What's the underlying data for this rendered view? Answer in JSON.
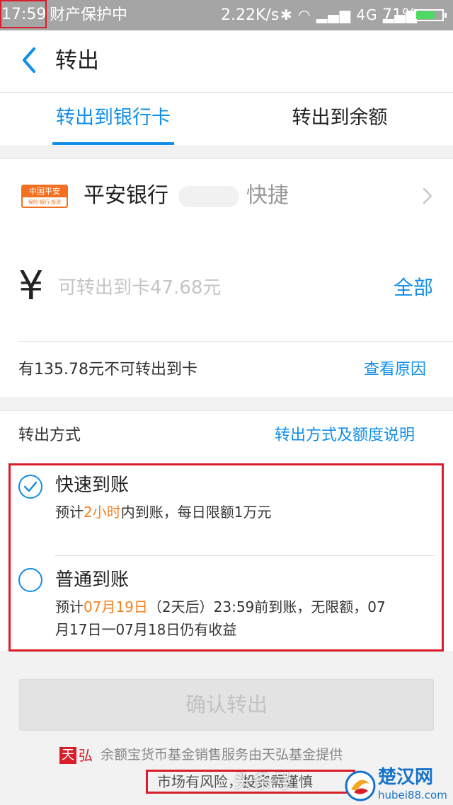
{
  "status_bar": {
    "time": "17:59",
    "note": "财产保护中",
    "speed": "2.22K/s",
    "network": "4G",
    "battery": "71%",
    "battery_level": 0.71,
    "icons": [
      "bluetooth-icon",
      "wifi-icon",
      "signal-icon"
    ]
  },
  "header": {
    "title": "转出",
    "back_icon": "chevron-left-icon"
  },
  "tabs": [
    {
      "label": "转出到银行卡",
      "active": true
    },
    {
      "label": "转出到余额",
      "active": false
    }
  ],
  "bank": {
    "logo_text": "中国平安",
    "logo_subtext": "保险·银行·投资",
    "name": "平安银行",
    "type": "快捷"
  },
  "amount": {
    "currency": "¥",
    "placeholder": "可转出到卡47.68元",
    "all_label": "全部",
    "unavailable_text": "有135.78元不可转出到卡",
    "reason_link": "查看原因"
  },
  "method": {
    "label": "转出方式",
    "info_link": "转出方式及额度说明",
    "options": [
      {
        "title": "快速到账",
        "selected": true,
        "desc_prefix": "预计",
        "desc_highlight": "2小时",
        "desc_suffix": "内到账，每日限额1万元"
      },
      {
        "title": "普通到账",
        "selected": false,
        "desc_prefix": "预计",
        "desc_highlight": "07月19日",
        "desc_suffix": "（2天后）23:59前到账，无限额，07",
        "desc_line2": "月17日一07月18日仍有收益"
      }
    ]
  },
  "confirm_label": "确认转出",
  "footer": {
    "logo_char_1": "天",
    "logo_char_2": "弘",
    "service_text": "余额宝货币基金销售服务由天弘基金提供",
    "risk_text": "市场有风险，投资需谨慎"
  },
  "watermark": {
    "toutiao": "头条号",
    "site_name": "楚汉网",
    "site_url": "hubei88.com"
  },
  "colors": {
    "accent": "#108ee9",
    "highlight": "#f5821f",
    "annotation_red": "#d81e2a",
    "bank_orange": "#f37021"
  }
}
